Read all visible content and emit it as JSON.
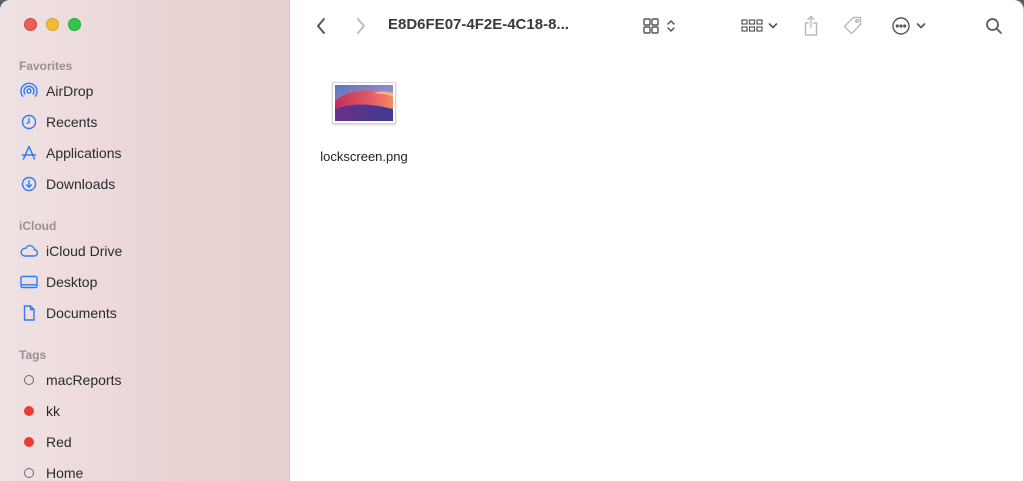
{
  "toolbar": {
    "title": "E8D6FE07-4F2E-4C18-8..."
  },
  "sidebar": {
    "favorites_title": "Favorites",
    "favorites": [
      {
        "label": "AirDrop",
        "icon": "airdrop-icon"
      },
      {
        "label": "Recents",
        "icon": "clock-icon"
      },
      {
        "label": "Applications",
        "icon": "applications-icon"
      },
      {
        "label": "Downloads",
        "icon": "download-icon"
      }
    ],
    "icloud_title": "iCloud",
    "icloud": [
      {
        "label": "iCloud Drive",
        "icon": "cloud-icon"
      },
      {
        "label": "Desktop",
        "icon": "desktop-icon"
      },
      {
        "label": "Documents",
        "icon": "document-icon"
      }
    ],
    "tags_title": "Tags",
    "tags": [
      {
        "label": "macReports",
        "color": "none"
      },
      {
        "label": "kk",
        "color": "#ee3b35"
      },
      {
        "label": "Red",
        "color": "#ee3b35"
      },
      {
        "label": "Home",
        "color": "none"
      }
    ]
  },
  "files": [
    {
      "name": "lockscreen.png"
    }
  ],
  "colors": {
    "accent": "#2f7bf5",
    "red_tag": "#ee3b35"
  }
}
